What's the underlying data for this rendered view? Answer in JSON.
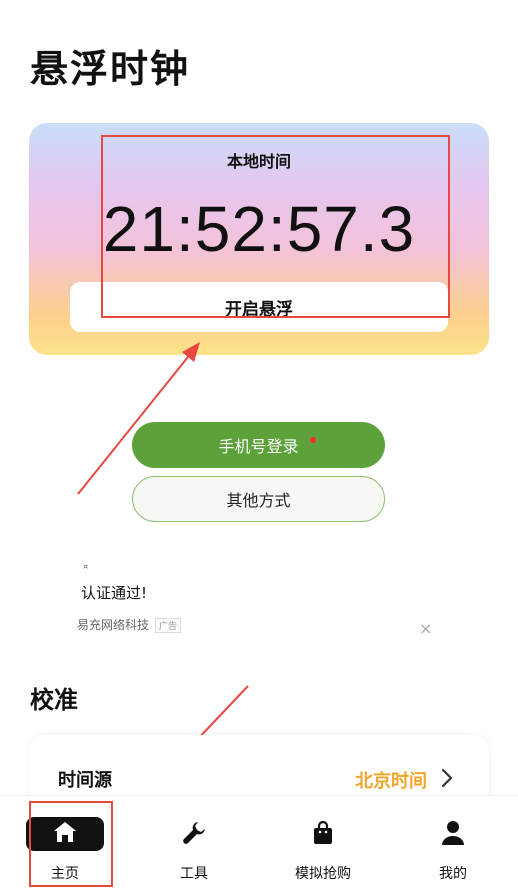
{
  "page": {
    "title": "悬浮时钟"
  },
  "clock": {
    "label": "本地时间",
    "time": "21:52:57.3",
    "float_button_label": "开启悬浮"
  },
  "login": {
    "phone_button_label": "手机号登录",
    "other_button_label": "其他方式"
  },
  "ad": {
    "small_icon": "¤",
    "text": "认证通过!",
    "company": "易充网络科技",
    "badge": "广告",
    "close": "×"
  },
  "calibration": {
    "section_title": "校准",
    "source_label": "时间源",
    "source_value": "北京时间"
  },
  "tabs": [
    {
      "label": "主页",
      "icon": "home-icon",
      "active": true
    },
    {
      "label": "工具",
      "icon": "wrench-icon",
      "active": false
    },
    {
      "label": "模拟抢购",
      "icon": "shopping-bag-icon",
      "active": false
    },
    {
      "label": "我的",
      "icon": "user-icon",
      "active": false
    }
  ],
  "colors": {
    "accent_green": "#5da13a",
    "highlight_red": "#e8483f",
    "time_source_orange": "#f2a529"
  }
}
